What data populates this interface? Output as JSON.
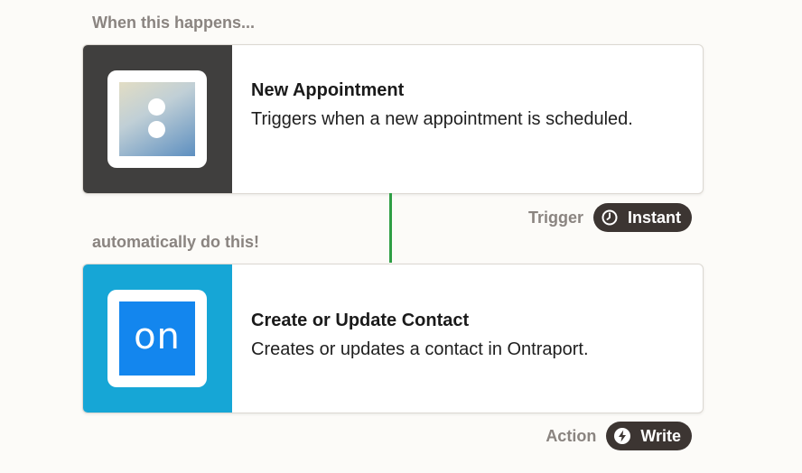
{
  "trigger_section": {
    "label": "When this happens...",
    "title": "New Appointment",
    "description": "Triggers when a new appointment is scheduled.",
    "type_label": "Trigger",
    "badge": {
      "label": "Instant",
      "icon": "clock-icon"
    }
  },
  "action_section": {
    "label": "automatically do this!",
    "title": "Create or Update Contact",
    "description": "Creates or updates a contact in Ontraport.",
    "type_label": "Action",
    "app_logo_text": "on",
    "badge": {
      "label": "Write",
      "icon": "lightning-bolt-icon"
    }
  },
  "colors": {
    "trigger_panel": "#403f3e",
    "action_panel": "#16a6d6",
    "connector": "#2f9e45",
    "badge_bg": "#3c3532",
    "muted_text": "#8a8480"
  }
}
